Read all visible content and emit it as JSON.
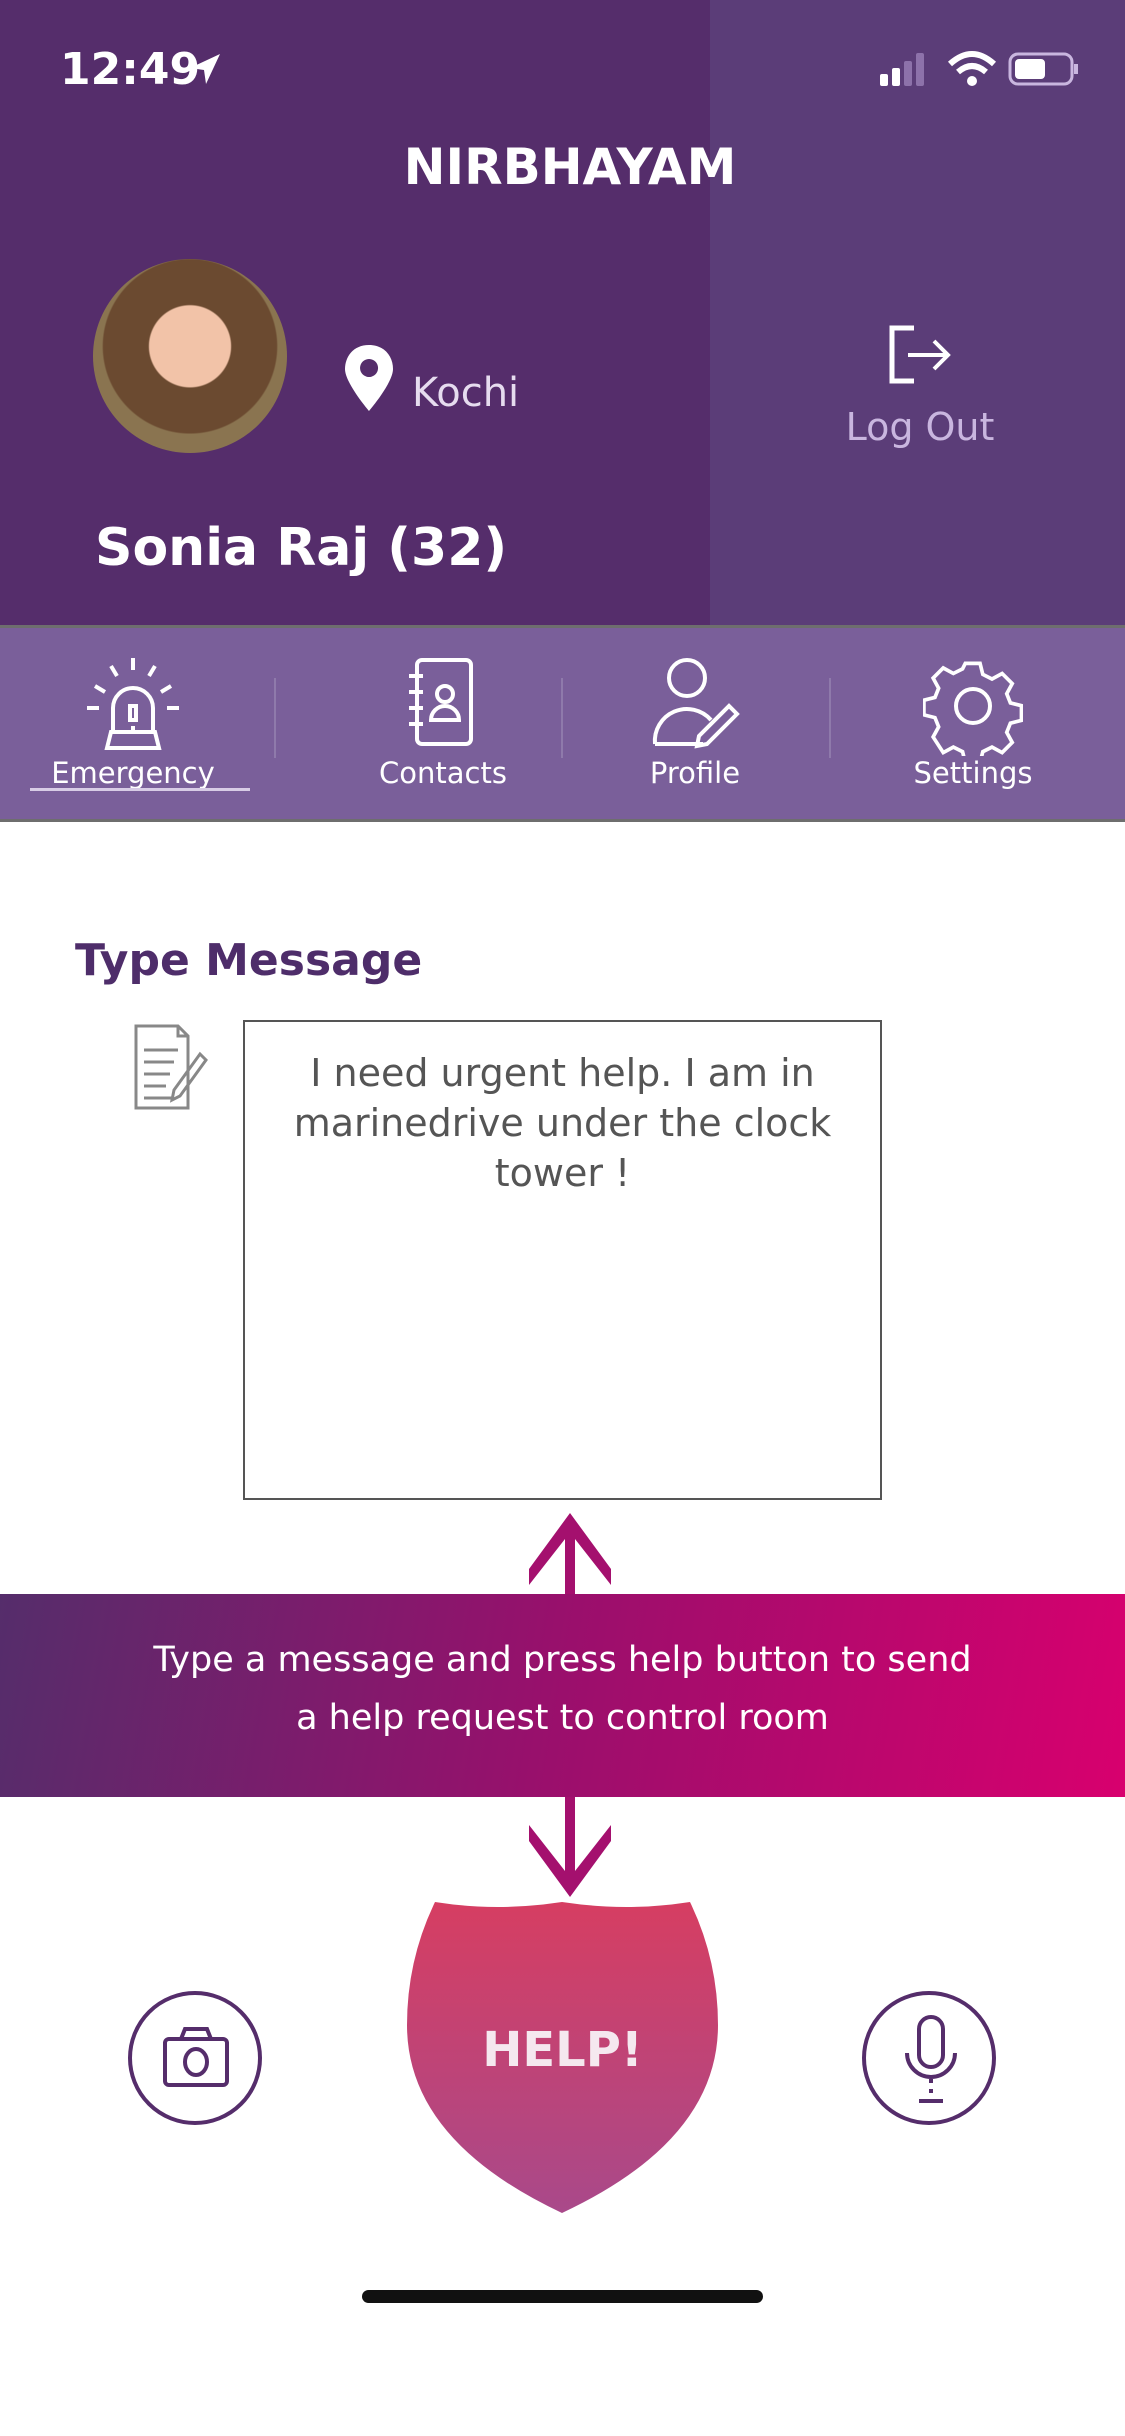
{
  "status_bar": {
    "time": "12:49",
    "icons": [
      "location-arrow-icon",
      "signal-icon",
      "wifi-icon",
      "battery-icon"
    ]
  },
  "header": {
    "app_title": "NIRBHAYAM",
    "location": "Kochi",
    "logout_label": "Log Out",
    "user_name": "Sonia Raj (32)"
  },
  "tabs": [
    {
      "label": "Emergency",
      "icon": "siren-icon",
      "active": true
    },
    {
      "label": "Contacts",
      "icon": "contact-book-icon"
    },
    {
      "label": "Profile",
      "icon": "user-edit-icon"
    },
    {
      "label": "Settings",
      "icon": "gear-icon"
    }
  ],
  "main": {
    "type_message_label": "Type Message",
    "message_text": "I need urgent help. I am in marinedrive under the clock tower !",
    "hint": "Type a message and press help button to send a help request to control room",
    "help_label": "HELP!"
  },
  "colors": {
    "primary": "#552d6b",
    "tab_bar": "#7a5f9a",
    "accent": "#d8006e"
  }
}
